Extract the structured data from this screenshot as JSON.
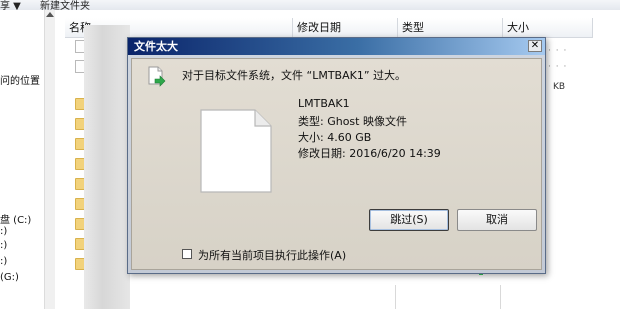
{
  "toolbar": {
    "item1": "享 ▼",
    "item2": "新建文件夹"
  },
  "left_pane": {
    "location_text": "问的位置",
    "drive_c": "盘 (C:)",
    "drive_d": ":)",
    "drive_e": ":)",
    "drive_f": ":)",
    "drive_g": "(G:)"
  },
  "columns": {
    "name": "名称",
    "modified": "修改日期",
    "type": "类型",
    "size": "大小"
  },
  "file_area": {
    "size_unit": "KB",
    "dots": "· · ·"
  },
  "dialog": {
    "title": "文件太大",
    "close_glyph": "✕",
    "message": "对于目标文件系统，文件 “LMTBAK1” 过大。",
    "file_name": "LMTBAK1",
    "file_type": "类型: Ghost 映像文件",
    "file_size": "大小: 4.60 GB",
    "file_date": "修改日期: 2016/6/20 14:39",
    "skip_button": "跳过(S)",
    "cancel_button": "取消",
    "checkbox_label": "为所有当前项目执行此操作(A)",
    "checkbox_checked": false
  },
  "icons": {
    "move": "move-file-icon",
    "file": "blank-file-icon",
    "folder": "folder-icon"
  },
  "colors": {
    "title_gradient_start": "#0a246a",
    "title_gradient_end": "#a6caf0",
    "dialog_client": "#dcd7cc",
    "arrow_green": "#2ea84b"
  }
}
